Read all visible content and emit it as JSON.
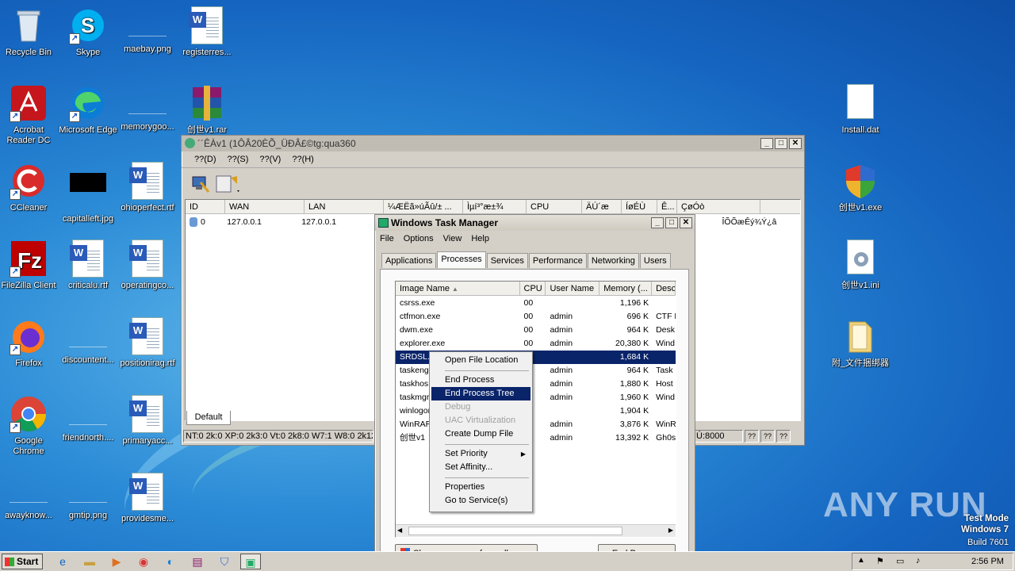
{
  "desktop": {
    "icons": [
      {
        "label": "Recycle Bin",
        "icon": "recycle-bin-icon"
      },
      {
        "label": "Skype",
        "icon": "skype-icon"
      },
      {
        "label": "maebay.png",
        "icon": "blank-image-icon"
      },
      {
        "label": "registerres...",
        "icon": "word-doc-icon"
      },
      {
        "label": "Acrobat Reader DC",
        "icon": "acrobat-icon"
      },
      {
        "label": "Microsoft Edge",
        "icon": "edge-icon"
      },
      {
        "label": "memorygoo...",
        "icon": "blank-image-icon"
      },
      {
        "label": "创世v1.rar",
        "icon": "winrar-icon"
      },
      {
        "label": "CCleaner",
        "icon": "ccleaner-icon"
      },
      {
        "label": "capitalleft.jpg",
        "icon": "black-image-icon"
      },
      {
        "label": "ohioperfect.rtf",
        "icon": "word-doc-icon"
      },
      {
        "label": "FileZilla Client",
        "icon": "filezilla-icon"
      },
      {
        "label": "criticalu.rtf",
        "icon": "word-doc-icon"
      },
      {
        "label": "operatingco...",
        "icon": "word-doc-icon"
      },
      {
        "label": "Firefox",
        "icon": "firefox-icon"
      },
      {
        "label": "discountent...",
        "icon": "blank-image-icon"
      },
      {
        "label": "positionirag.rtf",
        "icon": "word-doc-icon"
      },
      {
        "label": "Google Chrome",
        "icon": "chrome-icon"
      },
      {
        "label": "friendnorth....",
        "icon": "blank-image-icon"
      },
      {
        "label": "primaryacc...",
        "icon": "word-doc-icon"
      },
      {
        "label": "awayknow...",
        "icon": "blank-image-icon"
      },
      {
        "label": "gmtip.png",
        "icon": "blank-image-icon"
      },
      {
        "label": "providesme...",
        "icon": "word-doc-icon"
      },
      {
        "label": "Install.dat",
        "icon": "file-icon"
      },
      {
        "label": "创世v1.exe",
        "icon": "shield-exe-icon"
      },
      {
        "label": "创世v1.ini",
        "icon": "ini-gear-icon"
      },
      {
        "label": "附_文件捆绑器",
        "icon": "folder-icon"
      }
    ]
  },
  "bgwin": {
    "title": "´´ÊÀv1 (1ÔÂ20ÈÕ_ÜÐÂ£©tg:qua360",
    "menu": [
      "??(D)",
      "??(S)",
      "??(V)",
      "??(H)"
    ],
    "columns": [
      "ID",
      "WAN",
      "LAN",
      "¼ÆËã»úÃû/±  ...",
      "Ìµí³°æ±¾",
      "CPU",
      "ÄÚ´æ",
      "ÍøÉÙ",
      "Ê...",
      "ÇøÓò"
    ],
    "row": {
      "id": "0",
      "wan": "127.0.0.1",
      "lan": "127.0.0.1",
      "region": "ÎÕÕæÊý¾Ý¿â"
    },
    "tab": "Default",
    "status_left": "NT:0 2k:0 XP:0 2k3:0 Vt:0 2k8:0 W7:1 W8:0 2k12",
    "status_port": "Ú:8000",
    "status_boxes": [
      "??",
      "??",
      "??"
    ]
  },
  "taskmgr": {
    "title": "Windows Task Manager",
    "menu": [
      "File",
      "Options",
      "View",
      "Help"
    ],
    "tabs": [
      "Applications",
      "Processes",
      "Services",
      "Performance",
      "Networking",
      "Users"
    ],
    "columns": [
      "Image Name",
      "CPU",
      "User Name",
      "Memory (...",
      "Desc"
    ],
    "rows": [
      {
        "name": "csrss.exe",
        "cpu": "00",
        "user": "",
        "mem": "1,196 K",
        "desc": ""
      },
      {
        "name": "ctfmon.exe",
        "cpu": "00",
        "user": "admin",
        "mem": "696 K",
        "desc": "CTF L"
      },
      {
        "name": "dwm.exe",
        "cpu": "00",
        "user": "admin",
        "mem": "964 K",
        "desc": "Desk"
      },
      {
        "name": "explorer.exe",
        "cpu": "00",
        "user": "admin",
        "mem": "20,380 K",
        "desc": "Wind"
      },
      {
        "name": "SRDSL.e",
        "cpu": "0",
        "user": "",
        "mem": "1,684 K",
        "desc": ""
      },
      {
        "name": "taskeng",
        "cpu": "0",
        "user": "admin",
        "mem": "964 K",
        "desc": "Task"
      },
      {
        "name": "taskhos",
        "cpu": "0",
        "user": "admin",
        "mem": "1,880 K",
        "desc": "Host"
      },
      {
        "name": "taskmgr",
        "cpu": "0",
        "user": "admin",
        "mem": "1,960 K",
        "desc": "Wind"
      },
      {
        "name": "winlogon",
        "cpu": "0",
        "user": "",
        "mem": "1,904 K",
        "desc": ""
      },
      {
        "name": "WinRAR",
        "cpu": "0",
        "user": "admin",
        "mem": "3,876 K",
        "desc": "WinR"
      },
      {
        "name": "创世v1",
        "cpu": "0",
        "user": "admin",
        "mem": "13,392 K",
        "desc": "Gh0s"
      }
    ],
    "show_all_label": "Show processes from all users",
    "end_process_label": "End Process"
  },
  "context_menu": {
    "items": [
      {
        "label": "Open File Location",
        "state": "normal"
      },
      {
        "sep": true
      },
      {
        "label": "End Process",
        "state": "normal"
      },
      {
        "label": "End Process Tree",
        "state": "highlighted"
      },
      {
        "label": "Debug",
        "state": "disabled"
      },
      {
        "label": "UAC Virtualization",
        "state": "disabled"
      },
      {
        "label": "Create Dump File",
        "state": "normal"
      },
      {
        "sep": true
      },
      {
        "label": "Set Priority",
        "state": "normal",
        "submenu": true
      },
      {
        "label": "Set Affinity...",
        "state": "normal"
      },
      {
        "sep": true
      },
      {
        "label": "Properties",
        "state": "normal"
      },
      {
        "label": "Go to Service(s)",
        "state": "normal"
      }
    ]
  },
  "taskbar": {
    "start_label": "Start",
    "clock": "2:56 PM"
  },
  "watermark": {
    "brand": "ANY RUN",
    "line1": "Test Mode",
    "line2": "Windows 7",
    "line3": "Build 7601"
  }
}
